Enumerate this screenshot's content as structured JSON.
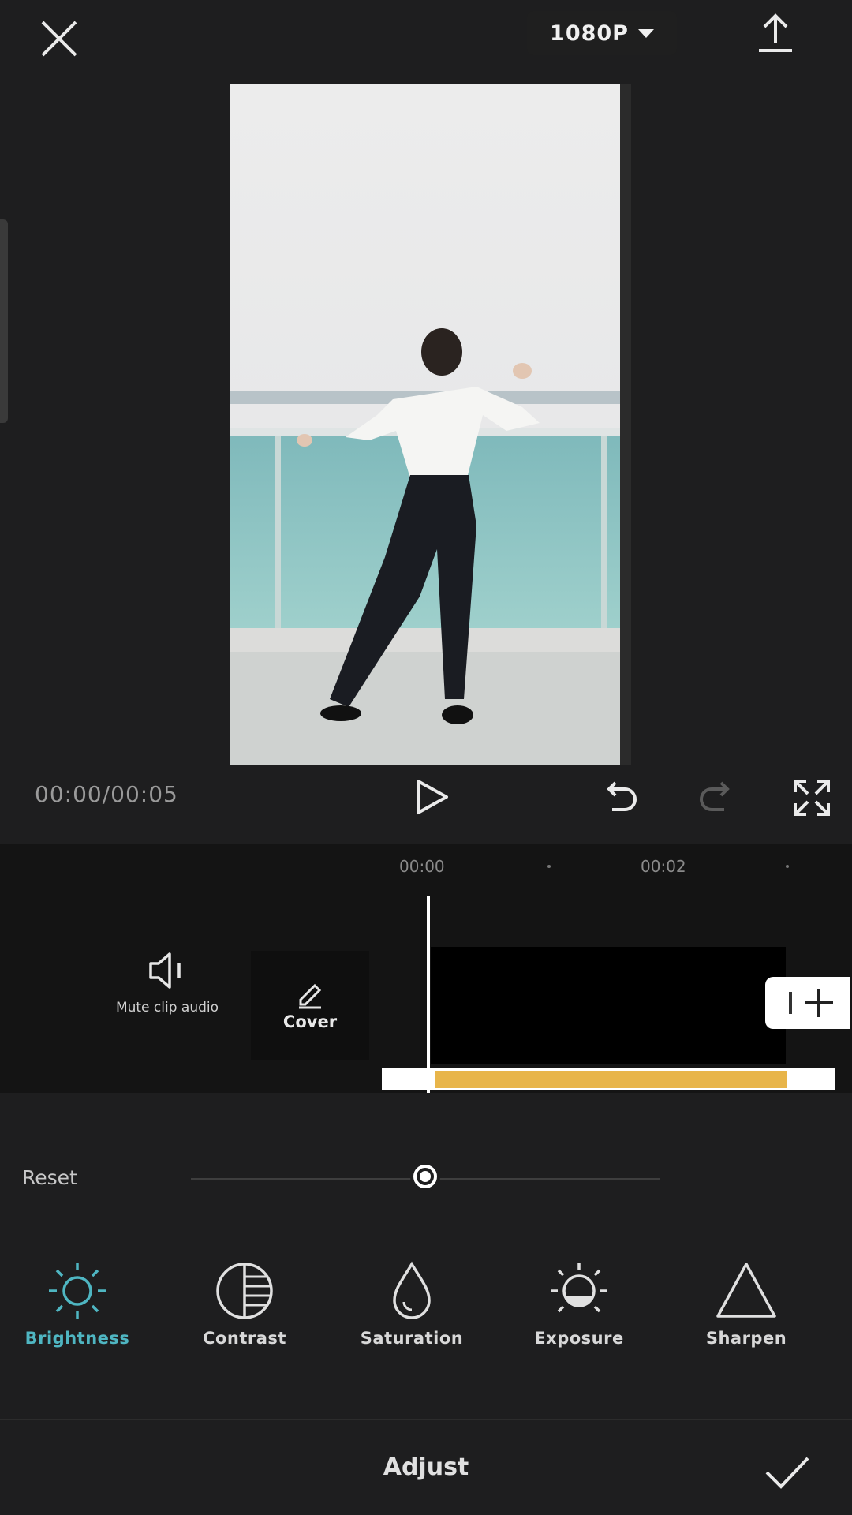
{
  "header": {
    "close_icon": "close-icon",
    "resolution": "1080P",
    "export_icon": "upload-icon"
  },
  "player": {
    "timecode": "00:00/00:05",
    "play_icon": "play-icon",
    "undo_icon": "undo-icon",
    "redo_icon": "redo-icon",
    "fullscreen_icon": "fullscreen-icon"
  },
  "timeline": {
    "ruler": [
      "00:00",
      "00:02"
    ],
    "mute_label": "Mute clip audio",
    "cover_label": "Cover"
  },
  "adjust": {
    "reset_label": "Reset",
    "slider_value_fraction": 0.5,
    "tools": [
      {
        "label": "Brightness",
        "icon": "sun-icon",
        "active": true
      },
      {
        "label": "Contrast",
        "icon": "contrast-icon",
        "active": false
      },
      {
        "label": "Saturation",
        "icon": "drop-icon",
        "active": false
      },
      {
        "label": "Exposure",
        "icon": "exposure-icon",
        "active": false
      },
      {
        "label": "Sharpen",
        "icon": "triangle-icon",
        "active": false
      }
    ],
    "title": "Adjust",
    "confirm_icon": "check-icon"
  },
  "colors": {
    "accent": "#4fb6c2",
    "audio_bar": "#e8b54a",
    "background": "#1e1e1f"
  }
}
